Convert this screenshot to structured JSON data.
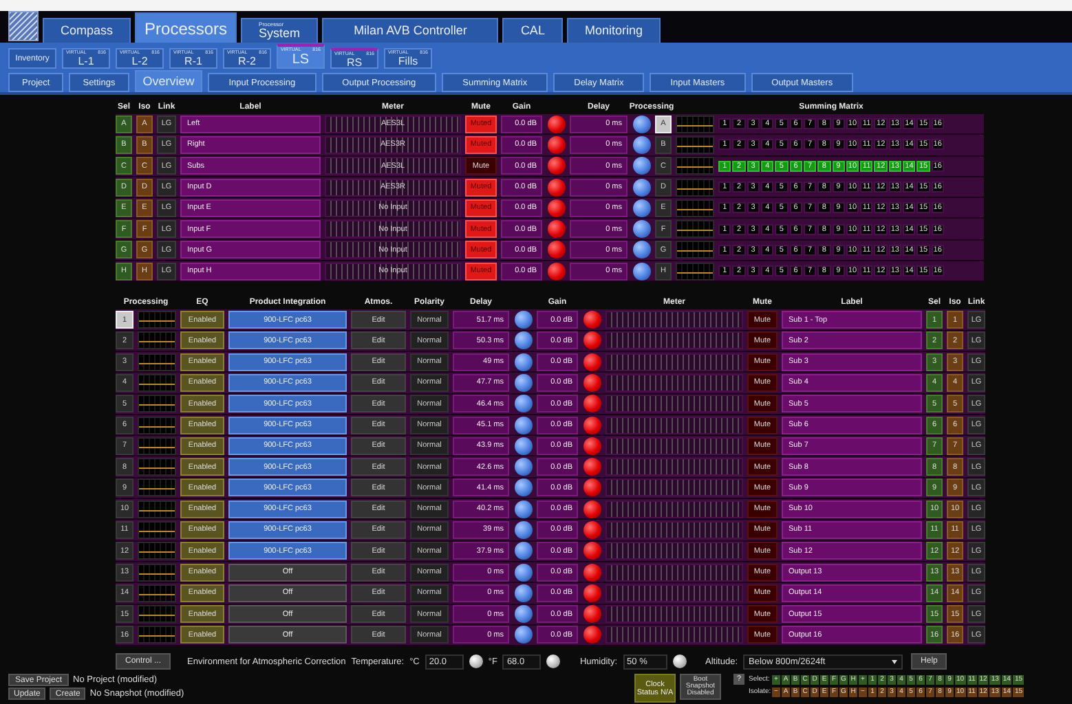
{
  "main_tabs": [
    {
      "label": "Compass",
      "selected": false
    },
    {
      "label": "Processors",
      "selected": true
    },
    {
      "caption": "Processor",
      "label": "System",
      "selected": false
    },
    {
      "label": "Milan AVB Controller",
      "selected": false
    },
    {
      "label": "CAL",
      "selected": false
    },
    {
      "label": "Monitoring",
      "selected": false
    }
  ],
  "device_tabs": [
    {
      "kind": "plain",
      "label": "Inventory",
      "selected": false,
      "linked": false
    },
    {
      "kind": "device",
      "caption": "VIRTUAL",
      "model": "816",
      "label": "L-1",
      "selected": false,
      "linked": false
    },
    {
      "kind": "device",
      "caption": "VIRTUAL",
      "model": "816",
      "label": "L-2",
      "selected": false,
      "linked": false
    },
    {
      "kind": "device",
      "caption": "VIRTUAL",
      "model": "816",
      "label": "R-1",
      "selected": false,
      "linked": false
    },
    {
      "kind": "device",
      "caption": "VIRTUAL",
      "model": "816",
      "label": "R-2",
      "selected": false,
      "linked": false
    },
    {
      "kind": "device",
      "caption": "VIRTUAL",
      "model": "816",
      "label": "LS",
      "selected": true,
      "linked": true
    },
    {
      "kind": "device",
      "caption": "VIRTUAL",
      "model": "816",
      "label": "RS",
      "selected": false,
      "linked": true
    },
    {
      "kind": "device",
      "caption": "VIRTUAL",
      "model": "816",
      "label": "Fills",
      "selected": false,
      "linked": false
    }
  ],
  "view_tabs": [
    {
      "label": "Project",
      "selected": false
    },
    {
      "label": "Settings",
      "selected": false
    },
    {
      "label": "Overview",
      "selected": true
    },
    {
      "label": "Input Processing",
      "selected": false
    },
    {
      "label": "Output Processing",
      "selected": false
    },
    {
      "label": "Summing Matrix",
      "selected": false
    },
    {
      "label": "Delay Matrix",
      "selected": false
    },
    {
      "label": "Input Masters",
      "selected": false
    },
    {
      "label": "Output Masters",
      "selected": false
    }
  ],
  "inputs": {
    "columns": [
      "Sel",
      "Iso",
      "Link",
      "Label",
      "Meter",
      "Mute",
      "Gain",
      "Delay",
      "Processing",
      "Summing Matrix"
    ],
    "rows": [
      {
        "sel": "A",
        "iso": "A",
        "link": "LG",
        "label": "Left",
        "meter": "AES3L",
        "mute": "Muted",
        "muted": true,
        "gain": "0.0 dB",
        "delay": "0 ms",
        "processing": "A",
        "processing_selected": true,
        "matrix": [
          {
            "label": "1",
            "on": false
          },
          {
            "label": "2",
            "on": false
          },
          {
            "label": "3",
            "on": false
          },
          {
            "label": "4",
            "on": false
          },
          {
            "label": "5",
            "on": false
          },
          {
            "label": "6",
            "on": false
          },
          {
            "label": "7",
            "on": false
          },
          {
            "label": "8",
            "on": false
          },
          {
            "label": "9",
            "on": false
          },
          {
            "label": "10",
            "on": false
          },
          {
            "label": "11",
            "on": false
          },
          {
            "label": "12",
            "on": false
          },
          {
            "label": "13",
            "on": false
          },
          {
            "label": "14",
            "on": false
          },
          {
            "label": "15",
            "on": false
          },
          {
            "label": "16",
            "on": false
          }
        ]
      },
      {
        "sel": "B",
        "iso": "B",
        "link": "LG",
        "label": "Right",
        "meter": "AES3R",
        "mute": "Muted",
        "muted": true,
        "gain": "0.0 dB",
        "delay": "0 ms",
        "processing": "B",
        "processing_selected": false,
        "matrix": [
          {
            "label": "1",
            "on": false
          },
          {
            "label": "2",
            "on": false
          },
          {
            "label": "3",
            "on": false
          },
          {
            "label": "4",
            "on": false
          },
          {
            "label": "5",
            "on": false
          },
          {
            "label": "6",
            "on": false
          },
          {
            "label": "7",
            "on": false
          },
          {
            "label": "8",
            "on": false
          },
          {
            "label": "9",
            "on": false
          },
          {
            "label": "10",
            "on": false
          },
          {
            "label": "11",
            "on": false
          },
          {
            "label": "12",
            "on": false
          },
          {
            "label": "13",
            "on": false
          },
          {
            "label": "14",
            "on": false
          },
          {
            "label": "15",
            "on": false
          },
          {
            "label": "16",
            "on": false
          }
        ]
      },
      {
        "sel": "C",
        "iso": "C",
        "link": "LG",
        "label": "Subs",
        "meter": "AES3L",
        "mute": "Mute",
        "muted": false,
        "gain": "0.0 dB",
        "delay": "0 ms",
        "processing": "C",
        "processing_selected": false,
        "matrix": [
          {
            "label": "1",
            "on": true
          },
          {
            "label": "2",
            "on": true
          },
          {
            "label": "3",
            "on": true
          },
          {
            "label": "4",
            "on": true
          },
          {
            "label": "5",
            "on": true
          },
          {
            "label": "6",
            "on": true
          },
          {
            "label": "7",
            "on": true
          },
          {
            "label": "8",
            "on": true
          },
          {
            "label": "9",
            "on": true
          },
          {
            "label": "10",
            "on": true
          },
          {
            "label": "11",
            "on": true
          },
          {
            "label": "12",
            "on": true
          },
          {
            "label": "13",
            "on": true
          },
          {
            "label": "14",
            "on": true
          },
          {
            "label": "15",
            "on": true
          },
          {
            "label": "16",
            "on": false
          }
        ]
      },
      {
        "sel": "D",
        "iso": "D",
        "link": "LG",
        "label": "Input D",
        "meter": "AES3R",
        "mute": "Muted",
        "muted": true,
        "gain": "0.0 dB",
        "delay": "0 ms",
        "processing": "D",
        "processing_selected": false,
        "matrix": [
          {
            "label": "1",
            "on": false
          },
          {
            "label": "2",
            "on": false
          },
          {
            "label": "3",
            "on": false
          },
          {
            "label": "4",
            "on": false
          },
          {
            "label": "5",
            "on": false
          },
          {
            "label": "6",
            "on": false
          },
          {
            "label": "7",
            "on": false
          },
          {
            "label": "8",
            "on": false
          },
          {
            "label": "9",
            "on": false
          },
          {
            "label": "10",
            "on": false
          },
          {
            "label": "11",
            "on": false
          },
          {
            "label": "12",
            "on": false
          },
          {
            "label": "13",
            "on": false
          },
          {
            "label": "14",
            "on": false
          },
          {
            "label": "15",
            "on": false
          },
          {
            "label": "16",
            "on": false
          }
        ]
      },
      {
        "sel": "E",
        "iso": "E",
        "link": "LG",
        "label": "Input E",
        "meter": "No Input",
        "mute": "Muted",
        "muted": true,
        "gain": "0.0 dB",
        "delay": "0 ms",
        "processing": "E",
        "processing_selected": false,
        "matrix": [
          {
            "label": "1",
            "on": false
          },
          {
            "label": "2",
            "on": false
          },
          {
            "label": "3",
            "on": false
          },
          {
            "label": "4",
            "on": false
          },
          {
            "label": "5",
            "on": false
          },
          {
            "label": "6",
            "on": false
          },
          {
            "label": "7",
            "on": false
          },
          {
            "label": "8",
            "on": false
          },
          {
            "label": "9",
            "on": false
          },
          {
            "label": "10",
            "on": false
          },
          {
            "label": "11",
            "on": false
          },
          {
            "label": "12",
            "on": false
          },
          {
            "label": "13",
            "on": false
          },
          {
            "label": "14",
            "on": false
          },
          {
            "label": "15",
            "on": false
          },
          {
            "label": "16",
            "on": false
          }
        ]
      },
      {
        "sel": "F",
        "iso": "F",
        "link": "LG",
        "label": "Input F",
        "meter": "No Input",
        "mute": "Muted",
        "muted": true,
        "gain": "0.0 dB",
        "delay": "0 ms",
        "processing": "F",
        "processing_selected": false,
        "matrix": [
          {
            "label": "1",
            "on": false
          },
          {
            "label": "2",
            "on": false
          },
          {
            "label": "3",
            "on": false
          },
          {
            "label": "4",
            "on": false
          },
          {
            "label": "5",
            "on": false
          },
          {
            "label": "6",
            "on": false
          },
          {
            "label": "7",
            "on": false
          },
          {
            "label": "8",
            "on": false
          },
          {
            "label": "9",
            "on": false
          },
          {
            "label": "10",
            "on": false
          },
          {
            "label": "11",
            "on": false
          },
          {
            "label": "12",
            "on": false
          },
          {
            "label": "13",
            "on": false
          },
          {
            "label": "14",
            "on": false
          },
          {
            "label": "15",
            "on": false
          },
          {
            "label": "16",
            "on": false
          }
        ]
      },
      {
        "sel": "G",
        "iso": "G",
        "link": "LG",
        "label": "Input G",
        "meter": "No Input",
        "mute": "Muted",
        "muted": true,
        "gain": "0.0 dB",
        "delay": "0 ms",
        "processing": "G",
        "processing_selected": false,
        "matrix": [
          {
            "label": "1",
            "on": false
          },
          {
            "label": "2",
            "on": false
          },
          {
            "label": "3",
            "on": false
          },
          {
            "label": "4",
            "on": false
          },
          {
            "label": "5",
            "on": false
          },
          {
            "label": "6",
            "on": false
          },
          {
            "label": "7",
            "on": false
          },
          {
            "label": "8",
            "on": false
          },
          {
            "label": "9",
            "on": false
          },
          {
            "label": "10",
            "on": false
          },
          {
            "label": "11",
            "on": false
          },
          {
            "label": "12",
            "on": false
          },
          {
            "label": "13",
            "on": false
          },
          {
            "label": "14",
            "on": false
          },
          {
            "label": "15",
            "on": false
          },
          {
            "label": "16",
            "on": false
          }
        ]
      },
      {
        "sel": "H",
        "iso": "H",
        "link": "LG",
        "label": "Input H",
        "meter": "No Input",
        "mute": "Muted",
        "muted": true,
        "gain": "0.0 dB",
        "delay": "0 ms",
        "processing": "H",
        "processing_selected": false,
        "matrix": [
          {
            "label": "1",
            "on": false
          },
          {
            "label": "2",
            "on": false
          },
          {
            "label": "3",
            "on": false
          },
          {
            "label": "4",
            "on": false
          },
          {
            "label": "5",
            "on": false
          },
          {
            "label": "6",
            "on": false
          },
          {
            "label": "7",
            "on": false
          },
          {
            "label": "8",
            "on": false
          },
          {
            "label": "9",
            "on": false
          },
          {
            "label": "10",
            "on": false
          },
          {
            "label": "11",
            "on": false
          },
          {
            "label": "12",
            "on": false
          },
          {
            "label": "13",
            "on": false
          },
          {
            "label": "14",
            "on": false
          },
          {
            "label": "15",
            "on": false
          },
          {
            "label": "16",
            "on": false
          }
        ]
      }
    ]
  },
  "outputs": {
    "columns": [
      "Processing",
      "EQ",
      "Product Integration",
      "Atmos.",
      "Polarity",
      "Delay",
      "Gain",
      "Meter",
      "Mute",
      "Label",
      "Sel",
      "Iso",
      "Link"
    ],
    "rows": [
      {
        "processing": "1",
        "processing_selected": true,
        "eq": "Enabled",
        "integration": "900-LFC pc63",
        "integration_on": true,
        "atmos": "Edit",
        "polarity": "Normal",
        "delay": "51.7 ms",
        "gain": "0.0 dB",
        "mute": "Mute",
        "muted": false,
        "label": "Sub 1 - Top",
        "sel": "1",
        "iso": "1",
        "link": "LG"
      },
      {
        "processing": "2",
        "processing_selected": false,
        "eq": "Enabled",
        "integration": "900-LFC pc63",
        "integration_on": true,
        "atmos": "Edit",
        "polarity": "Normal",
        "delay": "50.3 ms",
        "gain": "0.0 dB",
        "mute": "Mute",
        "muted": false,
        "label": "Sub 2",
        "sel": "2",
        "iso": "2",
        "link": "LG"
      },
      {
        "processing": "3",
        "processing_selected": false,
        "eq": "Enabled",
        "integration": "900-LFC pc63",
        "integration_on": true,
        "atmos": "Edit",
        "polarity": "Normal",
        "delay": "49 ms",
        "gain": "0.0 dB",
        "mute": "Mute",
        "muted": false,
        "label": "Sub 3",
        "sel": "3",
        "iso": "3",
        "link": "LG"
      },
      {
        "processing": "4",
        "processing_selected": false,
        "eq": "Enabled",
        "integration": "900-LFC pc63",
        "integration_on": true,
        "atmos": "Edit",
        "polarity": "Normal",
        "delay": "47.7 ms",
        "gain": "0.0 dB",
        "mute": "Mute",
        "muted": false,
        "label": "Sub 4",
        "sel": "4",
        "iso": "4",
        "link": "LG"
      },
      {
        "processing": "5",
        "processing_selected": false,
        "eq": "Enabled",
        "integration": "900-LFC pc63",
        "integration_on": true,
        "atmos": "Edit",
        "polarity": "Normal",
        "delay": "46.4 ms",
        "gain": "0.0 dB",
        "mute": "Mute",
        "muted": false,
        "label": "Sub 5",
        "sel": "5",
        "iso": "5",
        "link": "LG"
      },
      {
        "processing": "6",
        "processing_selected": false,
        "eq": "Enabled",
        "integration": "900-LFC pc63",
        "integration_on": true,
        "atmos": "Edit",
        "polarity": "Normal",
        "delay": "45.1 ms",
        "gain": "0.0 dB",
        "mute": "Mute",
        "muted": false,
        "label": "Sub 6",
        "sel": "6",
        "iso": "6",
        "link": "LG"
      },
      {
        "processing": "7",
        "processing_selected": false,
        "eq": "Enabled",
        "integration": "900-LFC pc63",
        "integration_on": true,
        "atmos": "Edit",
        "polarity": "Normal",
        "delay": "43.9 ms",
        "gain": "0.0 dB",
        "mute": "Mute",
        "muted": false,
        "label": "Sub 7",
        "sel": "7",
        "iso": "7",
        "link": "LG"
      },
      {
        "processing": "8",
        "processing_selected": false,
        "eq": "Enabled",
        "integration": "900-LFC pc63",
        "integration_on": true,
        "atmos": "Edit",
        "polarity": "Normal",
        "delay": "42.6 ms",
        "gain": "0.0 dB",
        "mute": "Mute",
        "muted": false,
        "label": "Sub 8",
        "sel": "8",
        "iso": "8",
        "link": "LG"
      },
      {
        "processing": "9",
        "processing_selected": false,
        "eq": "Enabled",
        "integration": "900-LFC pc63",
        "integration_on": true,
        "atmos": "Edit",
        "polarity": "Normal",
        "delay": "41.4 ms",
        "gain": "0.0 dB",
        "mute": "Mute",
        "muted": false,
        "label": "Sub 9",
        "sel": "9",
        "iso": "9",
        "link": "LG"
      },
      {
        "processing": "10",
        "processing_selected": false,
        "eq": "Enabled",
        "integration": "900-LFC pc63",
        "integration_on": true,
        "atmos": "Edit",
        "polarity": "Normal",
        "delay": "40.2 ms",
        "gain": "0.0 dB",
        "mute": "Mute",
        "muted": false,
        "label": "Sub 10",
        "sel": "10",
        "iso": "10",
        "link": "LG"
      },
      {
        "processing": "11",
        "processing_selected": false,
        "eq": "Enabled",
        "integration": "900-LFC pc63",
        "integration_on": true,
        "atmos": "Edit",
        "polarity": "Normal",
        "delay": "39 ms",
        "gain": "0.0 dB",
        "mute": "Mute",
        "muted": false,
        "label": "Sub 11",
        "sel": "11",
        "iso": "11",
        "link": "LG"
      },
      {
        "processing": "12",
        "processing_selected": false,
        "eq": "Enabled",
        "integration": "900-LFC pc63",
        "integration_on": true,
        "atmos": "Edit",
        "polarity": "Normal",
        "delay": "37.9 ms",
        "gain": "0.0 dB",
        "mute": "Mute",
        "muted": false,
        "label": "Sub 12",
        "sel": "12",
        "iso": "12",
        "link": "LG"
      },
      {
        "processing": "13",
        "processing_selected": false,
        "eq": "Enabled",
        "integration": "Off",
        "integration_on": false,
        "atmos": "Edit",
        "polarity": "Normal",
        "delay": "0 ms",
        "gain": "0.0 dB",
        "mute": "Mute",
        "muted": false,
        "label": "Output 13",
        "sel": "13",
        "iso": "13",
        "link": "LG"
      },
      {
        "processing": "14",
        "processing_selected": false,
        "eq": "Enabled",
        "integration": "Off",
        "integration_on": false,
        "atmos": "Edit",
        "polarity": "Normal",
        "delay": "0 ms",
        "gain": "0.0 dB",
        "mute": "Mute",
        "muted": false,
        "label": "Output 14",
        "sel": "14",
        "iso": "14",
        "link": "LG"
      },
      {
        "processing": "15",
        "processing_selected": false,
        "eq": "Enabled",
        "integration": "Off",
        "integration_on": false,
        "atmos": "Edit",
        "polarity": "Normal",
        "delay": "0 ms",
        "gain": "0.0 dB",
        "mute": "Mute",
        "muted": false,
        "label": "Output 15",
        "sel": "15",
        "iso": "15",
        "link": "LG"
      },
      {
        "processing": "16",
        "processing_selected": false,
        "eq": "Enabled",
        "integration": "Off",
        "integration_on": false,
        "atmos": "Edit",
        "polarity": "Normal",
        "delay": "0 ms",
        "gain": "0.0 dB",
        "mute": "Mute",
        "muted": false,
        "label": "Output 16",
        "sel": "16",
        "iso": "16",
        "link": "LG"
      }
    ]
  },
  "environment": {
    "control_button": "Control ...",
    "title": "Environment for Atmospheric Correction",
    "temperature_label": "Temperature:",
    "celsius_unit": "°C",
    "celsius": "20.0",
    "fahrenheit_unit": "°F",
    "fahrenheit": "68.0",
    "humidity_label": "Humidity:",
    "humidity": "50 %",
    "altitude_label": "Altitude:",
    "altitude": "Below 800m/2624ft",
    "help_button": "Help"
  },
  "project": {
    "save_button": "Save Project",
    "project_status": "No Project (modified)",
    "update_button": "Update",
    "create_button": "Create",
    "snapshot_status": "No Snapshot (modified)"
  },
  "clock_status": "Clock Status N/A",
  "boot_snapshot": "Boot Snapshot Disabled",
  "help_icon": "?",
  "select_bar": {
    "label": "Select:",
    "buttons": [
      "+",
      "A",
      "B",
      "C",
      "D",
      "E",
      "F",
      "G",
      "H",
      "+",
      "1",
      "2",
      "3",
      "4",
      "5",
      "6",
      "7",
      "8",
      "9",
      "10",
      "11",
      "12",
      "13",
      "14",
      "15"
    ]
  },
  "isolate_bar": {
    "label": "Isolate:",
    "buttons": [
      "−",
      "A",
      "B",
      "C",
      "D",
      "E",
      "F",
      "G",
      "H",
      "−",
      "1",
      "2",
      "3",
      "4",
      "5",
      "6",
      "7",
      "8",
      "9",
      "10",
      "11",
      "12",
      "13",
      "14",
      "15"
    ]
  }
}
